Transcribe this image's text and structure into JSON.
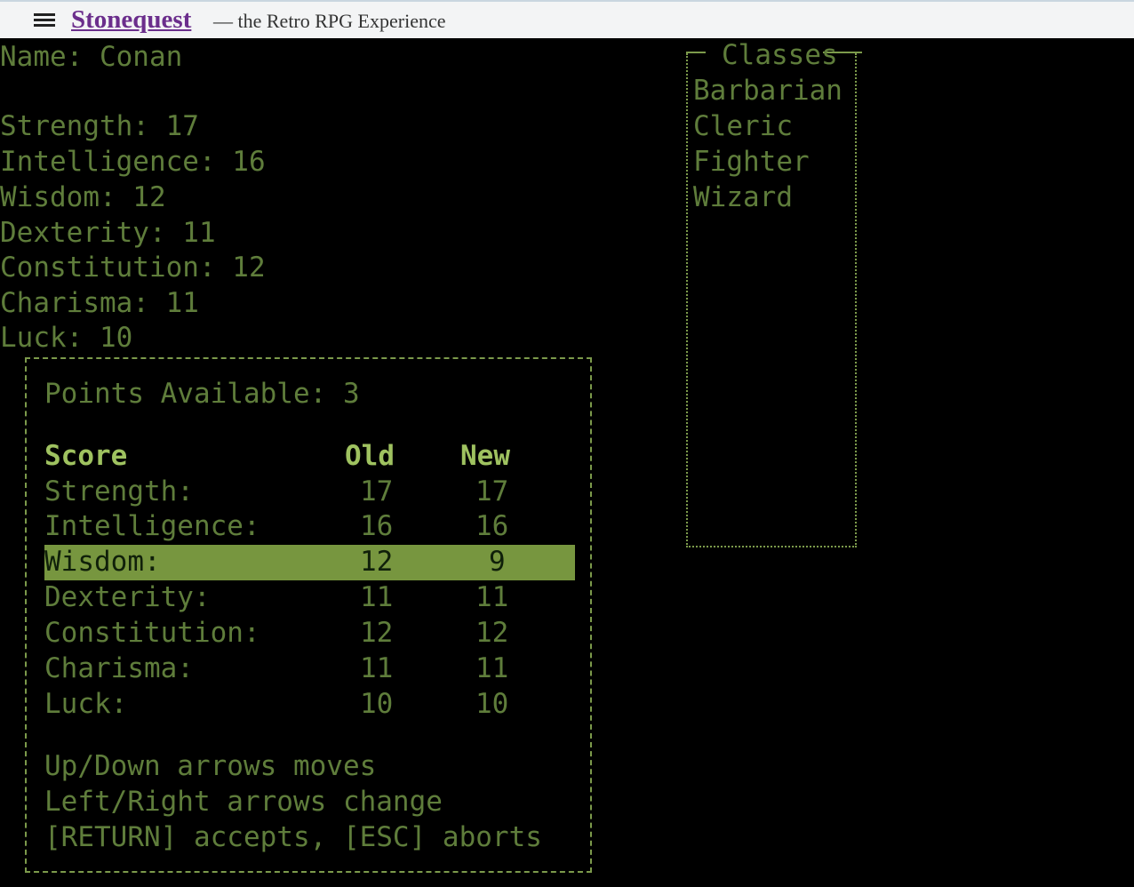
{
  "header": {
    "brand": "Stonequest",
    "tagline": "— the Retro RPG Experience"
  },
  "character": {
    "name_line": "Name: Conan",
    "stats": [
      "Strength: 17",
      "Intelligence: 16",
      "Wisdom: 12",
      "Dexterity: 11",
      "Constitution: 12",
      "Charisma: 11",
      "Luck: 10"
    ]
  },
  "classes": {
    "title": "Classes",
    "items": [
      "Barbarian",
      "Cleric",
      "Fighter",
      "Wizard"
    ]
  },
  "dialog": {
    "points_label": "Points Available: 3",
    "columns": {
      "score": "Score",
      "old": "Old",
      "new": "New"
    },
    "rows": [
      {
        "name": "Strength:",
        "old": "17",
        "new": "17"
      },
      {
        "name": "Intelligence:",
        "old": "16",
        "new": "16"
      },
      {
        "name": "Wisdom:",
        "old": "12",
        "new": "9"
      },
      {
        "name": "Dexterity:",
        "old": "11",
        "new": "11"
      },
      {
        "name": "Constitution:",
        "old": "12",
        "new": "12"
      },
      {
        "name": "Charisma:",
        "old": "11",
        "new": "11"
      },
      {
        "name": "Luck:",
        "old": "10",
        "new": "10"
      }
    ],
    "selected_row": "Wisdom:",
    "help": [
      "Up/Down arrows moves",
      "Left/Right arrows change",
      "[RETURN] accepts, [ESC] aborts"
    ]
  },
  "colors": {
    "terminal_text": "#7c9a4b",
    "highlight": "#77963f",
    "background": "#000000"
  }
}
